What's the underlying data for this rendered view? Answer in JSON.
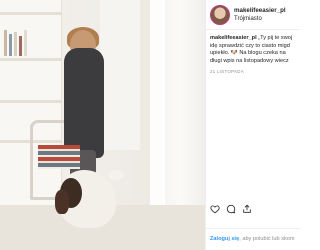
{
  "post": {
    "username": "makelifeeasier_pl",
    "location": "Trójmiasto",
    "caption_user": "makelifeeasier_pl",
    "caption_lines": [
      "„Ty pij te swoj",
      "idę sprawdzić czy to ciasto migd",
      "upiekło. 🐶 Na blogu czeka na",
      "długi wpis na listopadowy wiecz"
    ],
    "date": "21 LISTOPADA"
  },
  "footer": {
    "login_link": "Zaloguj się",
    "login_rest": ", aby polubić lub skom"
  },
  "icons": {
    "like": "heart-icon",
    "comment": "comment-icon",
    "share": "share-icon"
  },
  "colors": {
    "link": "#3897f0",
    "muted": "#8e8e8e",
    "text": "#262626"
  }
}
